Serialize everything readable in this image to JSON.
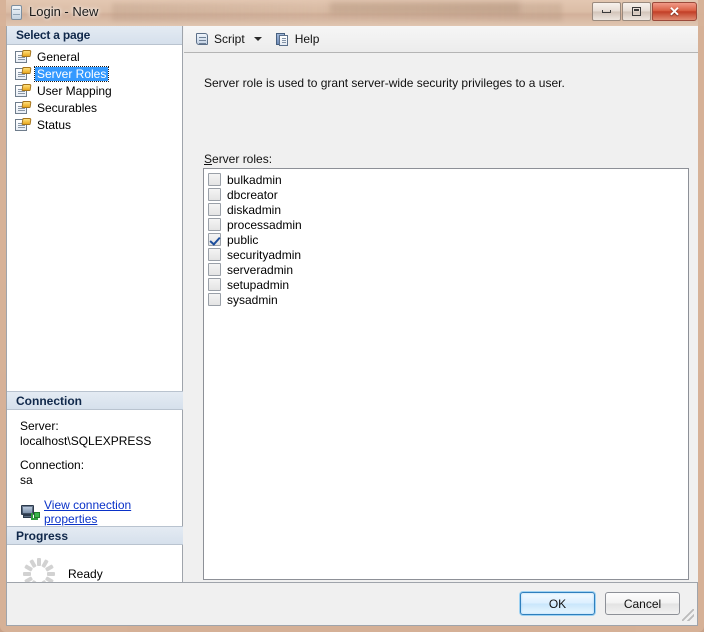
{
  "window": {
    "title": "Login - New",
    "icon": "server-database-icon",
    "caption_buttons": {
      "minimize": "minimize-button",
      "maximize": "restore-button",
      "close": "close-button",
      "close_glyph": "✕"
    }
  },
  "sidebar": {
    "header": "Select a page",
    "items": [
      {
        "label": "General",
        "selected": false
      },
      {
        "label": "Server Roles",
        "selected": true
      },
      {
        "label": "User Mapping",
        "selected": false
      },
      {
        "label": "Securables",
        "selected": false
      },
      {
        "label": "Status",
        "selected": false
      }
    ]
  },
  "connection": {
    "header": "Connection",
    "server_label": "Server:",
    "server_value": "localhost\\SQLEXPRESS",
    "connection_label": "Connection:",
    "connection_value": "sa",
    "link_text": "View connection properties",
    "link_color": "#0a32c8"
  },
  "progress": {
    "header": "Progress",
    "status": "Ready"
  },
  "toolbar": {
    "script_label": "Script",
    "help_label": "Help"
  },
  "main": {
    "description": "Server role is used to grant server-wide security privileges to a user.",
    "roles_label_accel": "S",
    "roles_label_rest": "erver roles:",
    "roles": [
      {
        "name": "bulkadmin",
        "checked": false
      },
      {
        "name": "dbcreator",
        "checked": false
      },
      {
        "name": "diskadmin",
        "checked": false
      },
      {
        "name": "processadmin",
        "checked": false
      },
      {
        "name": "public",
        "checked": true
      },
      {
        "name": "securityadmin",
        "checked": false
      },
      {
        "name": "serveradmin",
        "checked": false
      },
      {
        "name": "setupadmin",
        "checked": false
      },
      {
        "name": "sysadmin",
        "checked": false
      }
    ]
  },
  "buttons": {
    "ok": "OK",
    "cancel": "Cancel"
  },
  "colors": {
    "selection_blue": "#3399ff",
    "header_blue_text": "#10284a",
    "frame_tan": "#d7b298",
    "close_red": "#c23f27"
  }
}
